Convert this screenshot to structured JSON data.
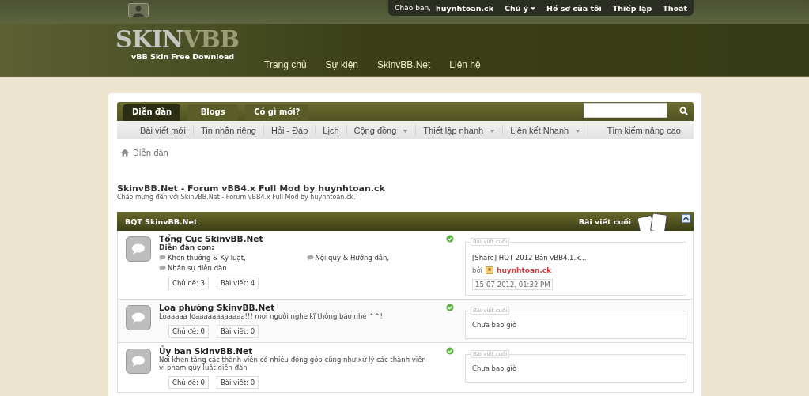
{
  "user_bar": {
    "greeting": "Chào bạn,",
    "username": "huynhtoan.ck",
    "links": [
      {
        "label": "Chú ý",
        "dropdown": true
      },
      {
        "label": "Hồ sơ của tôi",
        "dropdown": false
      },
      {
        "label": "Thiếp lập",
        "dropdown": false
      },
      {
        "label": "Thoát",
        "dropdown": false
      }
    ]
  },
  "logo": {
    "title_a": "SKIN",
    "title_b": "VBB",
    "tagline": "vBB Skin Free Download"
  },
  "main_nav": [
    "Trang chủ",
    "Sự kiện",
    "SkinvBB.Net",
    "Liên hệ"
  ],
  "tabs": [
    {
      "label": "Diễn đàn",
      "selected": true
    },
    {
      "label": "Blogs",
      "selected": false
    },
    {
      "label": "Có gì mới?",
      "selected": false
    }
  ],
  "sub_nav": [
    {
      "label": "Bài viết mới",
      "dropdown": false
    },
    {
      "label": "Tin nhắn riêng",
      "dropdown": false
    },
    {
      "label": "Hỏi - Đáp",
      "dropdown": false
    },
    {
      "label": "Lịch",
      "dropdown": false
    },
    {
      "label": "Cộng đồng",
      "dropdown": true
    },
    {
      "label": "Thiết lập nhanh",
      "dropdown": true
    },
    {
      "label": "Liên kết Nhanh",
      "dropdown": true
    }
  ],
  "advanced_search": "Tìm kiếm nâng cao",
  "breadcrumb": "Diễn đàn",
  "page_title": "SkinvBB.Net - Forum vBB4.x Full Mod by huynhtoan.ck",
  "page_subtitle": "Chào mừng đến với SkinvBB.Net - Forum vBB4.x Full Mod by huynhtoan.ck.",
  "category": {
    "title": "BQT SkinvBB.Net",
    "last_post_heading": "Bài viết cuối"
  },
  "forums": [
    {
      "title": "Tổng Cục SkinvBB.Net",
      "subforums_label": "Diễn đàn con:",
      "subforums": [
        "Khen thưởng & Kỷ luật,",
        "Nội quy & Hướng dẫn,",
        "Nhân sự diễn đàn"
      ],
      "threads": "Chủ đề: 3",
      "posts": "Bài viết: 4",
      "last_post_legend": "Bài viết cuối",
      "last_post": {
        "title": "[Share] HOT 2012 Bản vBB4.1.x...",
        "by": "bởi",
        "author": "huynhtoan.ck",
        "date": "15-07-2012, 01:32 PM"
      }
    },
    {
      "title": "Loa phường SkinvBB.Net",
      "description": "Loaaaaa loaaaaaaaaaaaa!!! mọi người nghe kĩ thông báo nhé ^^!",
      "threads": "Chủ đề: 0",
      "posts": "Bài viết: 0",
      "last_post_legend": "Bài viết cuối",
      "never": "Chưa bao giờ"
    },
    {
      "title": "Ủy ban SkinvBB.Net",
      "description": "Nơi khen tặng các thành viên có nhiều đóng góp cũng như xử lý các thành viên vi phạm quy luật diễn đàn",
      "threads": "Chủ đề: 0",
      "posts": "Bài viết: 0",
      "last_post_legend": "Bài viết cuối",
      "never": "Chưa bao giờ"
    }
  ]
}
